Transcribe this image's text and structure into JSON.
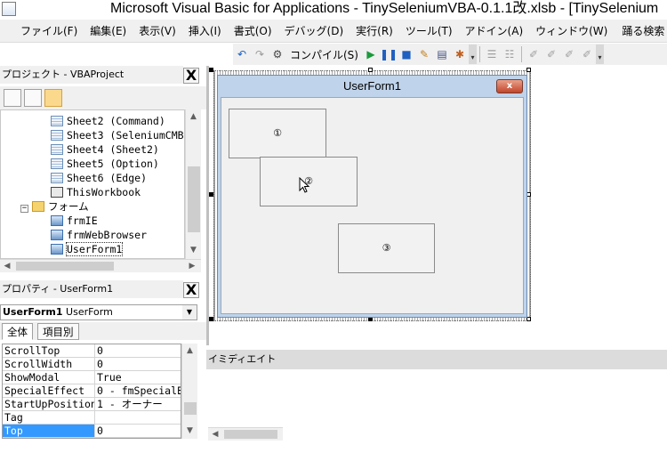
{
  "window": {
    "title": "Microsoft Visual Basic for Applications - TinySeleniumVBA-0.1.1改.xlsb - [TinySelenium"
  },
  "menu": {
    "items": [
      "ファイル(F)",
      "編集(E)",
      "表示(V)",
      "挿入(I)",
      "書式(O)",
      "デバッグ(D)",
      "実行(R)",
      "ツール(T)",
      "アドイン(A)",
      "ウィンドウ(W)"
    ],
    "help_label": "踊る検索"
  },
  "toolbar": {
    "compile_label": "コンパイル(S)"
  },
  "project": {
    "header": "プロジェクト - VBAProject",
    "close": "X",
    "tree": [
      {
        "label": "Sheet2 (Command)",
        "icon": "sheet-icon"
      },
      {
        "label": "Sheet3 (SeleniumCMB",
        "icon": "sheet-icon"
      },
      {
        "label": "Sheet4 (Sheet2)",
        "icon": "sheet-icon"
      },
      {
        "label": "Sheet5 (Option)",
        "icon": "sheet-icon"
      },
      {
        "label": "Sheet6 (Edge)",
        "icon": "sheet-icon"
      },
      {
        "label": "ThisWorkbook",
        "icon": "workbook-icon"
      },
      {
        "label": "フォーム",
        "icon": "folder-icon"
      },
      {
        "label": "frmIE",
        "icon": "form-icon"
      },
      {
        "label": "frmWebBrowser",
        "icon": "form-icon"
      },
      {
        "label": "UserForm1",
        "icon": "form-icon"
      }
    ]
  },
  "properties": {
    "header": "プロパティ - UserForm1",
    "close": "X",
    "object_name": "UserForm1",
    "object_type": "UserForm",
    "tabs": [
      "全体",
      "項目別"
    ],
    "rows": [
      {
        "name": "ScrollTop",
        "value": "0"
      },
      {
        "name": "ScrollWidth",
        "value": "0"
      },
      {
        "name": "ShowModal",
        "value": "True"
      },
      {
        "name": "SpecialEffect",
        "value": "0 - fmSpecialE"
      },
      {
        "name": "StartUpPosition",
        "value": "1 - オーナー"
      },
      {
        "name": "Tag",
        "value": ""
      },
      {
        "name": "Top",
        "value": "0"
      }
    ]
  },
  "userform": {
    "title": "UserForm1",
    "close": "x",
    "buttons": [
      "①",
      "②",
      "③"
    ]
  },
  "immediate": {
    "header": "イミディエイト"
  },
  "colors": {
    "selection": "#3399ff",
    "form_title": "#bfd3ea",
    "close_button": "#c2452a"
  }
}
